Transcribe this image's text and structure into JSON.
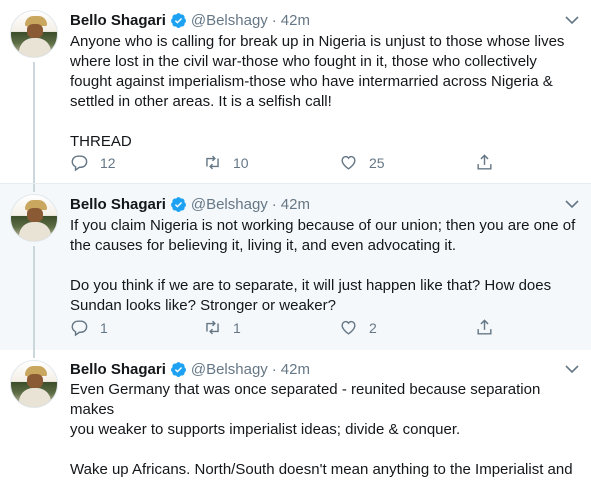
{
  "tweets": [
    {
      "author_name": "Bello Shagari",
      "handle": "@Belshagy",
      "separator": "·",
      "time": "42m",
      "text": "Anyone who is calling for break up in Nigeria is unjust to those whose lives\nwhere lost in the civil war-those who fought in it, those who collectively\nfought against imperialism-those who have intermarried across Nigeria &\nsettled in other areas. It is a selfish call!\n\nTHREAD",
      "replies": "12",
      "retweets": "10",
      "likes": "25"
    },
    {
      "author_name": "Bello Shagari",
      "handle": "@Belshagy",
      "separator": "·",
      "time": "42m",
      "text": "If you claim Nigeria is not working because of our union; then you are one of\nthe causes for believing it, living it, and even advocating it.\n\nDo you think if we are to separate, it will just happen like that? How does\nSundan looks like? Stronger or weaker?",
      "replies": "1",
      "retweets": "1",
      "likes": "2"
    },
    {
      "author_name": "Bello Shagari",
      "handle": "@Belshagy",
      "separator": "·",
      "time": "42m",
      "text": "Even Germany that was once separated - reunited because separation makes\nyou weaker to supports imperialist ideas; divide & conquer.\n\nWake up Africans. North/South doesn't mean anything to the Imperialist and\nthe exploiters of our resources. We are the same before them."
    }
  ],
  "icons": {
    "verified": "verified-badge-icon",
    "caret": "chevron-down-icon",
    "reply": "reply-icon",
    "retweet": "retweet-icon",
    "like": "heart-icon",
    "share": "share-icon"
  },
  "colors": {
    "verified_blue": "#1da1f2",
    "secondary_text": "#657786",
    "thread_line": "#ccd6dd",
    "highlight_bg": "#f5f8fa"
  }
}
